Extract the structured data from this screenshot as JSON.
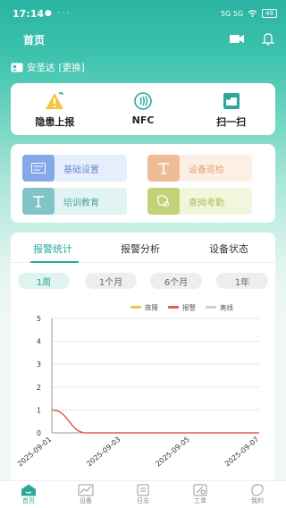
{
  "status": {
    "time": "17:14",
    "left": "● ···",
    "signal": "5G 5G",
    "battery": "49"
  },
  "header": {
    "title": "首页"
  },
  "user": {
    "name": "安圣达",
    "switch": "[更换]"
  },
  "quick": [
    {
      "label": "隐患上报",
      "icon": "warning-icon"
    },
    {
      "label": "NFC",
      "icon": "nfc-icon"
    },
    {
      "label": "扫一扫",
      "icon": "scan-icon"
    }
  ],
  "functions": [
    {
      "label": "基础设置"
    },
    {
      "label": "设备巡检"
    },
    {
      "label": "培训教育"
    },
    {
      "label": "查岗考勤"
    }
  ],
  "tabs": [
    "报警统计",
    "报警分析",
    "设备状态"
  ],
  "periods": [
    "1周",
    "1个月",
    "6个月",
    "1年"
  ],
  "nav": [
    "首页",
    "设备",
    "日志",
    "工单",
    "我的"
  ],
  "colors": {
    "accent": "#2ba89a",
    "fault": "#f5c542",
    "alarm": "#e05b5b",
    "offline": "#d0d0d0"
  },
  "chart_data": {
    "type": "line",
    "x": [
      "2025-09-01",
      "2025-09-02",
      "2025-09-03",
      "2025-09-04",
      "2025-09-05",
      "2025-09-06",
      "2025-09-07"
    ],
    "xticks": [
      "2025-09-01",
      "2025-09-03",
      "2025-09-05",
      "2025-09-07"
    ],
    "ylim": [
      0,
      5
    ],
    "yticks": [
      0,
      1,
      2,
      3,
      4,
      5
    ],
    "legend_position": "top-right",
    "series": [
      {
        "name": "故障",
        "color": "#f5c542",
        "values": [
          0,
          0,
          0,
          0,
          0,
          0,
          0
        ]
      },
      {
        "name": "报警",
        "color": "#e05b5b",
        "values": [
          1,
          0,
          0,
          0,
          0,
          0,
          0
        ]
      },
      {
        "name": "离线",
        "color": "#d0d0d0",
        "values": [
          0,
          0,
          0,
          0,
          0,
          0,
          0
        ]
      }
    ]
  }
}
